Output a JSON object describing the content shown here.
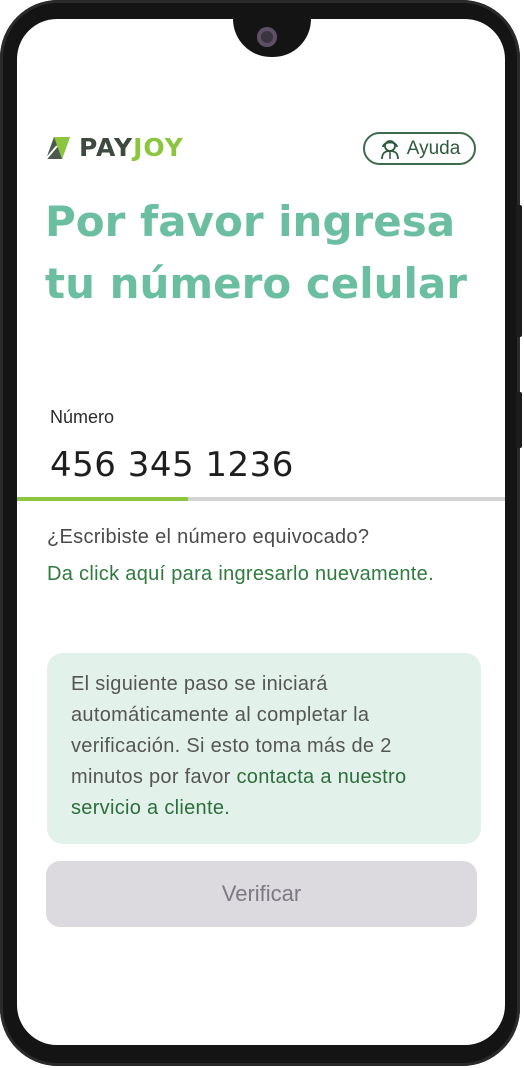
{
  "brand": {
    "part1": "PAY",
    "part2": "JOY",
    "accent": "#8cc63f",
    "dark": "#3e4a3f"
  },
  "header": {
    "help_label": "Ayuda",
    "help_icon": "support-agent-icon"
  },
  "title": {
    "line1": "Por favor ingresa",
    "line2": "tu número celular"
  },
  "phone_field": {
    "label": "Número",
    "value": "456 345 1236",
    "fill_fraction": 0.35
  },
  "wrong_number": {
    "question": "¿Escribiste el número equivocado?",
    "link": "Da click aquí para ingresarlo nuevamente."
  },
  "info": {
    "text": "El siguiente paso se iniciará automáticamente al completar la verificación. Si esto toma más de 2 minutos por favor ",
    "link": "contacta a nuestro servicio a cliente."
  },
  "verify_button": {
    "label": "Verificar",
    "state": "disabled"
  },
  "colors": {
    "title": "#6bbfa0",
    "link": "#2e7a3f",
    "info_bg": "#e2f1ea",
    "button_bg": "#dcdadf"
  }
}
